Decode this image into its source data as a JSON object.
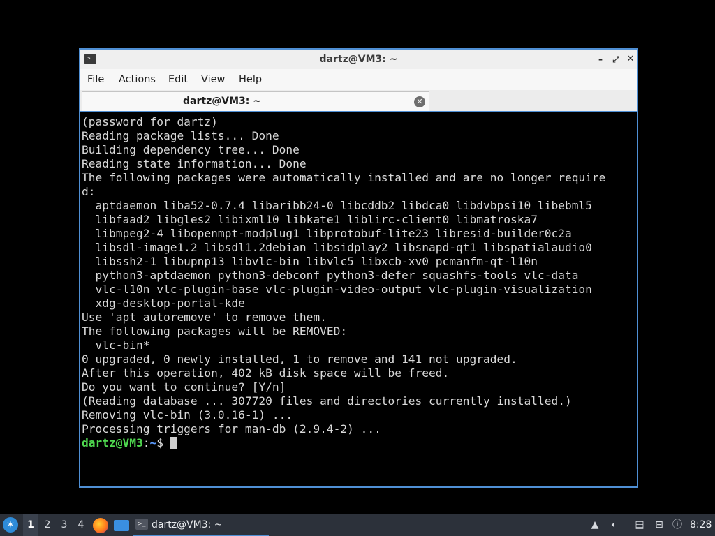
{
  "window": {
    "title": "dartz@VM3: ~",
    "icon": "terminal-icon"
  },
  "menu": [
    "File",
    "Actions",
    "Edit",
    "View",
    "Help"
  ],
  "tab": {
    "label": "dartz@VM3: ~"
  },
  "terminal": {
    "lines": [
      "(password for dartz)",
      "Reading package lists... Done",
      "Building dependency tree... Done",
      "Reading state information... Done",
      "The following packages were automatically installed and are no longer require",
      "d:",
      "  aptdaemon liba52-0.7.4 libaribb24-0 libcddb2 libdca0 libdvbpsi10 libebml5",
      "  libfaad2 libgles2 libixml10 libkate1 liblirc-client0 libmatroska7",
      "  libmpeg2-4 libopenmpt-modplug1 libprotobuf-lite23 libresid-builder0c2a",
      "  libsdl-image1.2 libsdl1.2debian libsidplay2 libsnapd-qt1 libspatialaudio0",
      "  libssh2-1 libupnp13 libvlc-bin libvlc5 libxcb-xv0 pcmanfm-qt-l10n",
      "  python3-aptdaemon python3-debconf python3-defer squashfs-tools vlc-data",
      "  vlc-l10n vlc-plugin-base vlc-plugin-video-output vlc-plugin-visualization",
      "  xdg-desktop-portal-kde",
      "Use 'apt autoremove' to remove them.",
      "The following packages will be REMOVED:",
      "  vlc-bin*",
      "0 upgraded, 0 newly installed, 1 to remove and 141 not upgraded.",
      "After this operation, 402 kB disk space will be freed.",
      "Do you want to continue? [Y/n]",
      "(Reading database ... 307720 files and directories currently installed.)",
      "Removing vlc-bin (3.0.16-1) ...",
      "Processing triggers for man-db (2.9.4-2) ..."
    ],
    "prompt_user": "dartz@VM3",
    "prompt_sep": ":",
    "prompt_path": "~",
    "prompt_symbol": "$ "
  },
  "taskbar": {
    "workspaces": [
      "1",
      "2",
      "3",
      "4"
    ],
    "active_workspace": "1",
    "task_label": "dartz@VM3: ~",
    "clock": "8:28"
  },
  "colors": {
    "accent": "#4f8fd4",
    "prompt_user": "#4fd84f",
    "prompt_path": "#5c9cff",
    "taskbar_bg": "#2c313a"
  }
}
